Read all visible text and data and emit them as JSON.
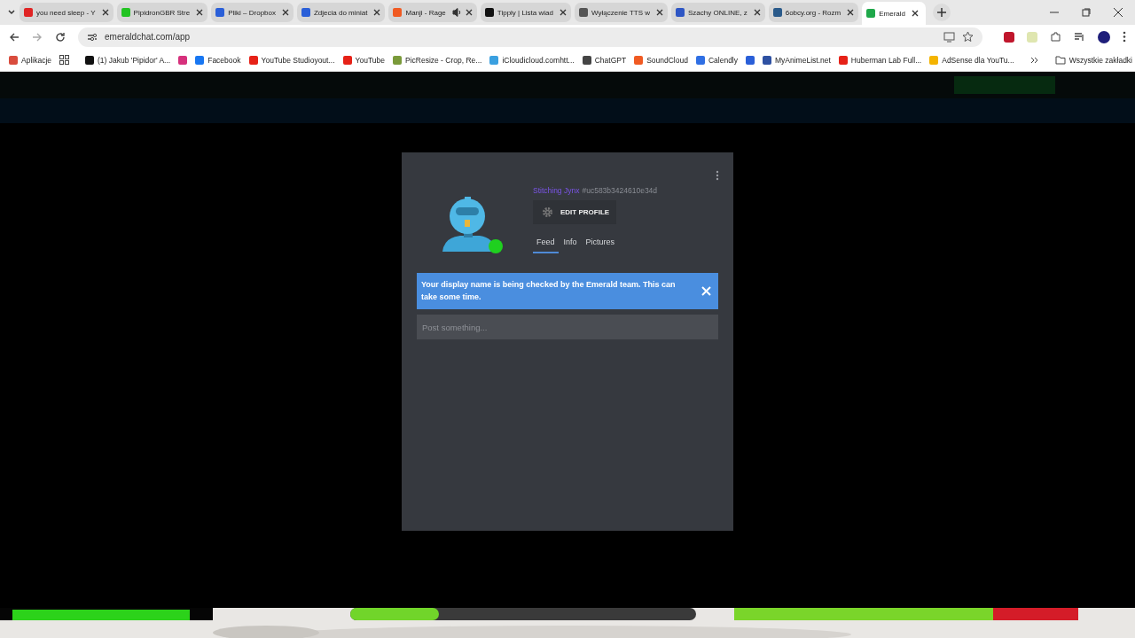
{
  "browser": {
    "tabs": [
      {
        "title": "you need sleep - Y",
        "color": "#e02424",
        "audio": false,
        "selected": false
      },
      {
        "title": "PipidronGBR Stre",
        "color": "#22c322",
        "audio": false,
        "selected": false
      },
      {
        "title": "Pliki – Dropbox",
        "color": "#2a5fd8",
        "audio": false,
        "selected": false
      },
      {
        "title": "Zdjecia do miniat",
        "color": "#2a5fd8",
        "audio": false,
        "selected": false
      },
      {
        "title": "Manji - Rage",
        "color": "#f05a22",
        "audio": true,
        "selected": false
      },
      {
        "title": "Tipply | Lista wiad",
        "color": "#111111",
        "audio": false,
        "selected": false
      },
      {
        "title": "Wyłączenie TTS w",
        "color": "#555555",
        "audio": false,
        "selected": false
      },
      {
        "title": "Szachy ONLINE, z",
        "color": "#2e56c4",
        "audio": false,
        "selected": false
      },
      {
        "title": "6obcy.org - Rozm",
        "color": "#2a5a8a",
        "audio": false,
        "selected": false
      },
      {
        "title": "Emerald",
        "color": "#1fa84a",
        "audio": false,
        "selected": true
      }
    ],
    "url": "emeraldchat.com/app",
    "bookmarks": [
      {
        "label": "Aplikacje",
        "color": "#d94c3d"
      },
      {
        "label": "(1) Jakub 'Pipidor' A...",
        "color": "#111111"
      },
      {
        "color": "#d6307c"
      },
      {
        "label": "Facebook",
        "color": "#1877f2"
      },
      {
        "label": "YouTube Studioyout...",
        "color": "#e62117"
      },
      {
        "label": "YouTube",
        "color": "#e62117"
      },
      {
        "label": "PicResize - Crop, Re...",
        "color": "#7a9a3a"
      },
      {
        "label": "iCloudicloud.comhtt...",
        "color": "#3aa0e0"
      },
      {
        "label": "ChatGPT",
        "color": "#444444"
      },
      {
        "label": "SoundCloud",
        "color": "#f05a22"
      },
      {
        "label": "Calendly",
        "color": "#2f6fe4"
      },
      {
        "color": "#2a5fd8"
      },
      {
        "label": "MyAnimeList.net",
        "color": "#2e51a2"
      },
      {
        "label": "Huberman Lab Full...",
        "color": "#e62117"
      },
      {
        "label": "AdSense dla YouTu...",
        "color": "#f4b400"
      }
    ],
    "all_bookmarks": "Wszystkie zakładki"
  },
  "profile": {
    "name": "Stitching Jynx",
    "tag": "#uc583b3424610e34d",
    "online": true,
    "edit_button": "EDIT PROFILE",
    "tabs": [
      {
        "label": "Feed",
        "selected": true
      },
      {
        "label": "Info",
        "selected": false
      },
      {
        "label": "Pictures",
        "selected": false
      }
    ],
    "notice": "Your display name is being checked by the Emerald team. This can take some time.",
    "post": {
      "placeholder": "Post something..."
    }
  }
}
